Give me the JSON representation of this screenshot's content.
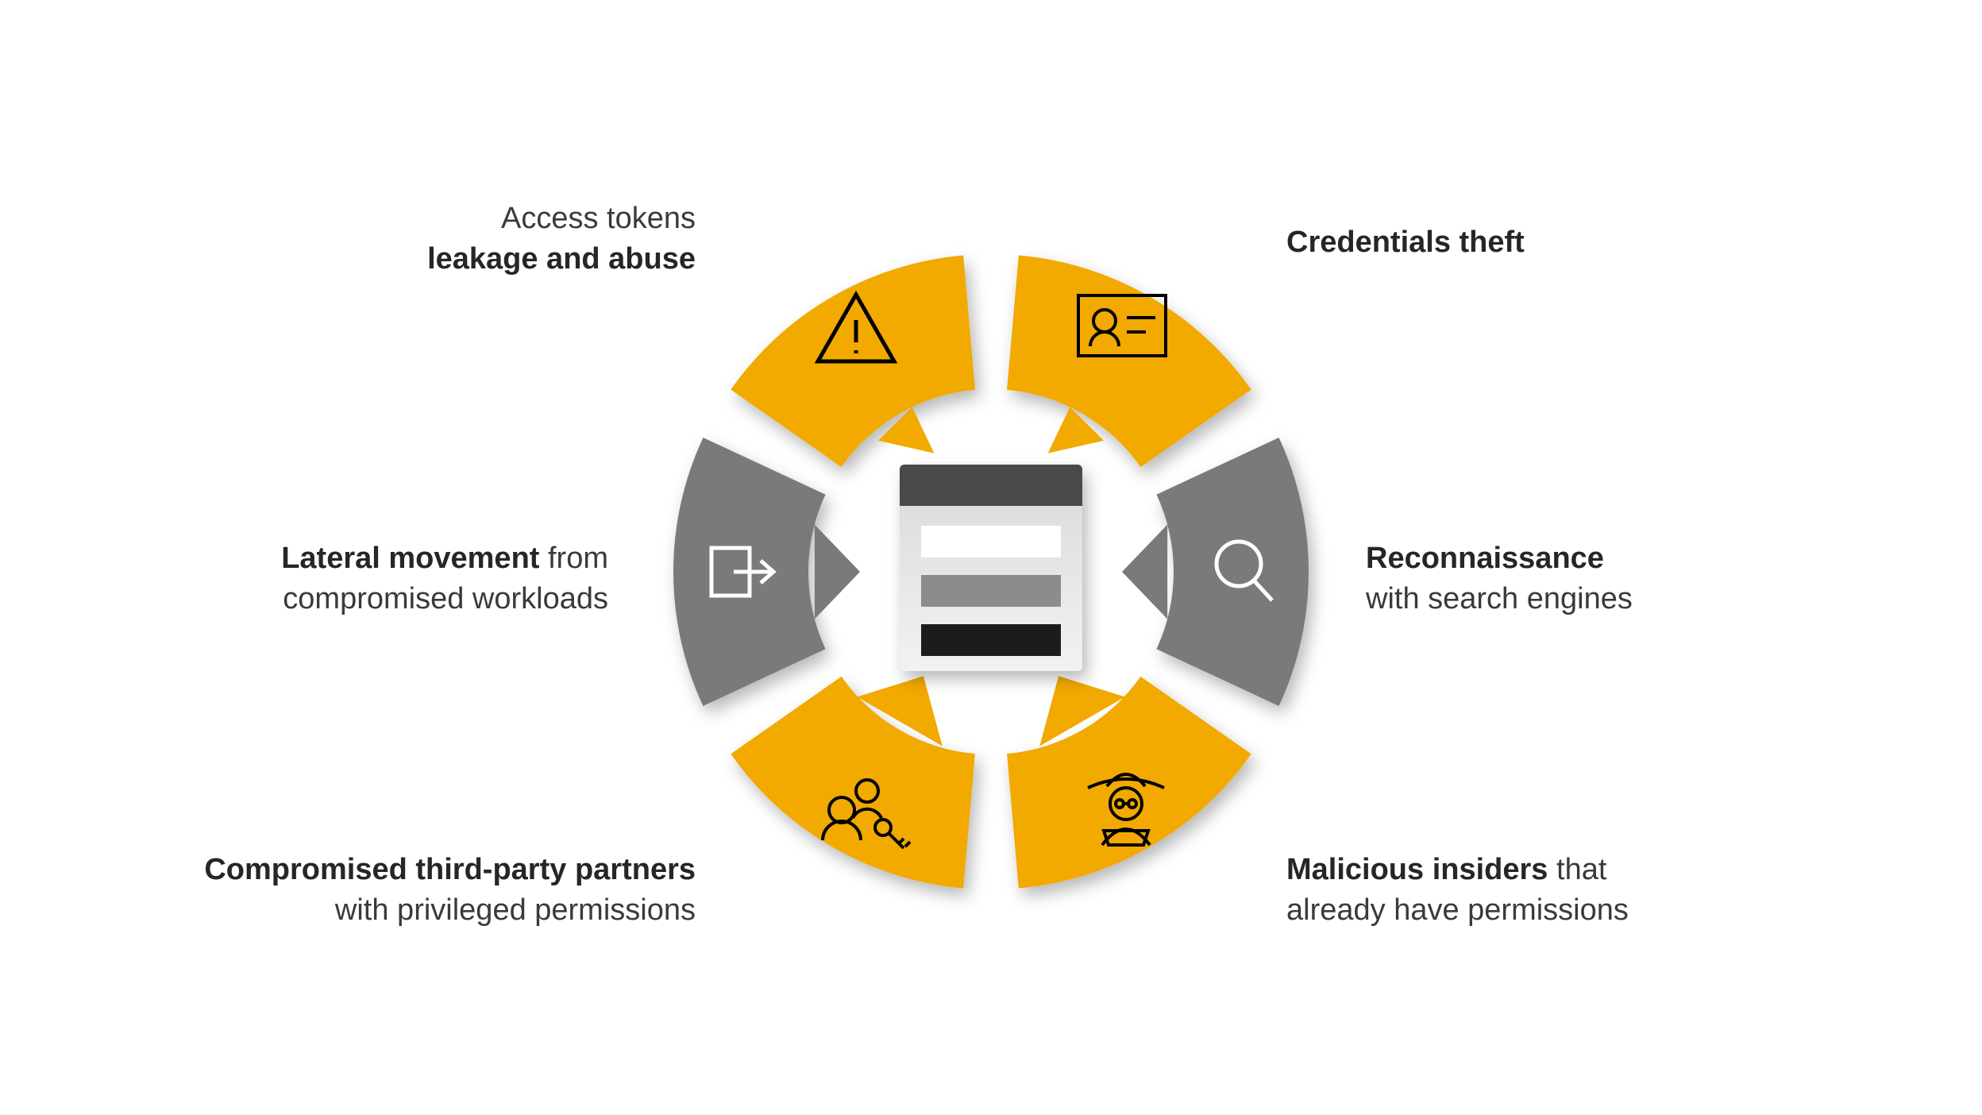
{
  "diagram": {
    "center_icon": "form-window",
    "segments": [
      {
        "id": "credentials-theft",
        "position": "top-right",
        "color": "yellow",
        "icon": "id-card-icon",
        "label_bold": "Credentials theft",
        "label_plain": ""
      },
      {
        "id": "reconnaissance",
        "position": "right",
        "color": "gray",
        "icon": "magnifier-icon",
        "label_bold": "Reconnaissance",
        "label_plain": "with search engines"
      },
      {
        "id": "malicious-insiders",
        "position": "bottom-right",
        "color": "yellow",
        "icon": "spy-icon",
        "label_bold": "Malicious insiders",
        "label_plain": " that already have permissions"
      },
      {
        "id": "compromised-partners",
        "position": "bottom-left",
        "color": "yellow",
        "icon": "users-key-icon",
        "label_bold": "Compromised third-party partners",
        "label_plain": " with privileged permissions"
      },
      {
        "id": "lateral-movement",
        "position": "left",
        "color": "gray",
        "icon": "exit-arrow-icon",
        "label_bold": "Lateral movement",
        "label_plain": " from compromised workloads"
      },
      {
        "id": "access-tokens",
        "position": "top-left",
        "color": "yellow",
        "icon": "warning-triangle-icon",
        "label_plain_top": "Access tokens",
        "label_bold": "leakage and abuse"
      }
    ],
    "colors": {
      "yellow": "#f2a900",
      "gray": "#7a7a7a",
      "shadow": "rgba(0,0,0,0.25)"
    }
  }
}
